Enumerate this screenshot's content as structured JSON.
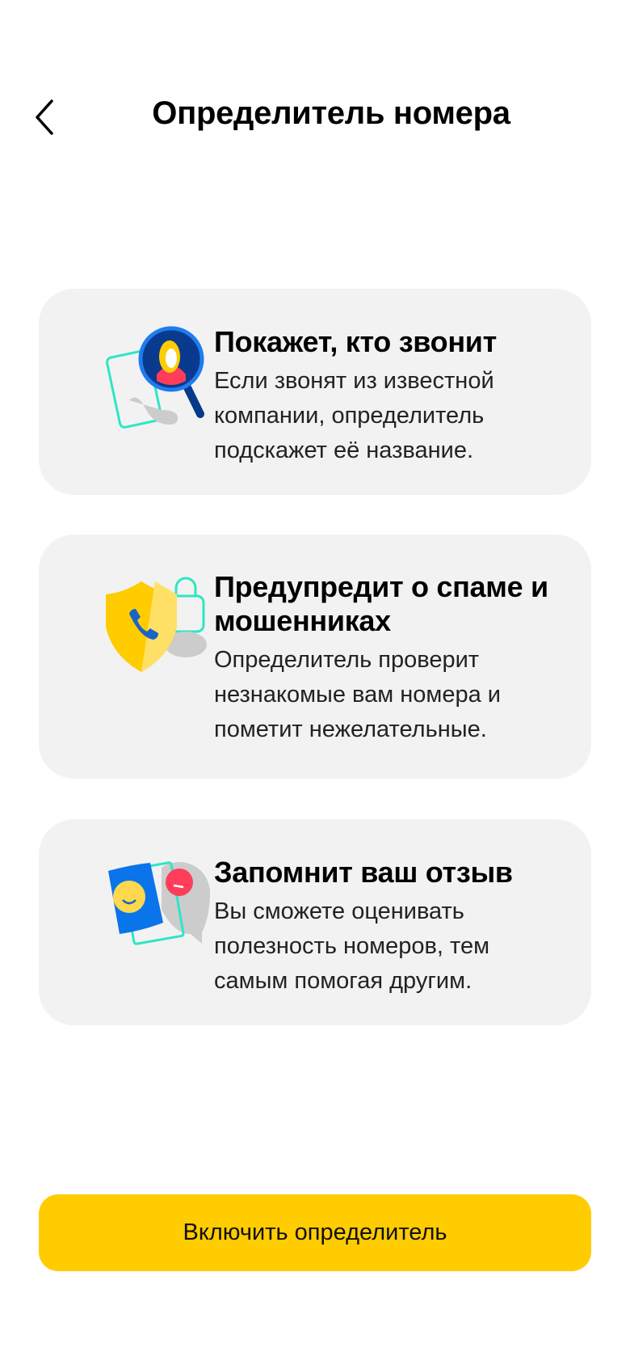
{
  "header": {
    "title": "Определитель номера",
    "back_icon": "chevron-left-icon"
  },
  "features": [
    {
      "icon": "magnifier-caller-icon",
      "title": "Покажет, кто звонит",
      "description": "Если звонят из известной компании, определитель подскажет её название."
    },
    {
      "icon": "shield-phone-icon",
      "title": "Предупредит о спаме и мошенниках",
      "description": "Определитель проверит незнакомые вам номера и пометит нежелательные."
    },
    {
      "icon": "review-smiley-icon",
      "title": "Запомнит ваш отзыв",
      "description": "Вы сможете оценивать полезность номеров, тем самым помогая другим."
    }
  ],
  "action": {
    "label": "Включить определитель"
  },
  "colors": {
    "accent": "#ffcc00",
    "card": "#f2f2f2"
  }
}
